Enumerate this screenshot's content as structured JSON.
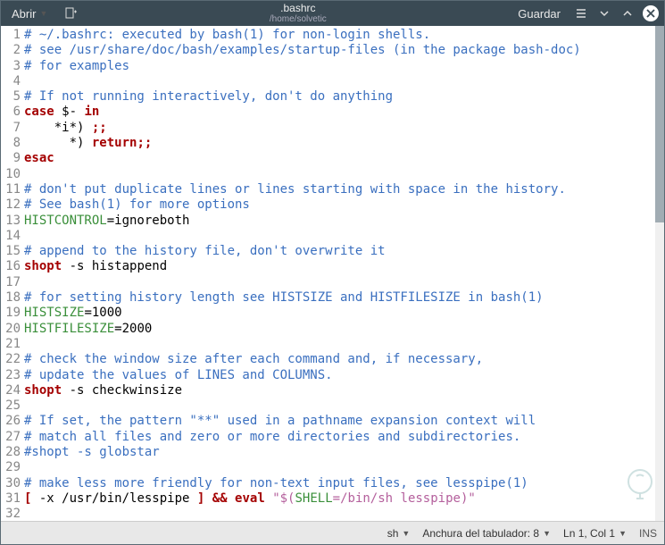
{
  "titlebar": {
    "open_label": "Abrir",
    "title": ".bashrc",
    "subtitle": "/home/solvetic",
    "save_label": "Guardar"
  },
  "code": {
    "lines": [
      {
        "n": 1,
        "t": [
          [
            "cmt",
            "# ~/.bashrc: executed by bash(1) for non-login shells."
          ]
        ]
      },
      {
        "n": 2,
        "t": [
          [
            "cmt",
            "# see /usr/share/doc/bash/examples/startup-files (in the package bash-doc)"
          ]
        ]
      },
      {
        "n": 3,
        "t": [
          [
            "cmt",
            "# for examples"
          ]
        ]
      },
      {
        "n": 4,
        "t": [
          [
            "",
            ""
          ]
        ]
      },
      {
        "n": 5,
        "t": [
          [
            "cmt",
            "# If not running interactively, don't do anything"
          ]
        ]
      },
      {
        "n": 6,
        "t": [
          [
            "kw",
            "case"
          ],
          [
            "",
            " $- "
          ],
          [
            "kw",
            "in"
          ]
        ]
      },
      {
        "n": 7,
        "t": [
          [
            "",
            "    *i*) "
          ],
          [
            "punc",
            ";;"
          ]
        ]
      },
      {
        "n": 8,
        "t": [
          [
            "",
            "      *) "
          ],
          [
            "kw",
            "return"
          ],
          [
            "punc",
            ";;"
          ]
        ]
      },
      {
        "n": 9,
        "t": [
          [
            "kw",
            "esac"
          ]
        ]
      },
      {
        "n": 10,
        "t": [
          [
            "",
            ""
          ]
        ]
      },
      {
        "n": 11,
        "t": [
          [
            "cmt",
            "# don't put duplicate lines or lines starting with space in the history."
          ]
        ]
      },
      {
        "n": 12,
        "t": [
          [
            "cmt",
            "# See bash(1) for more options"
          ]
        ]
      },
      {
        "n": 13,
        "t": [
          [
            "var",
            "HISTCONTROL"
          ],
          [
            "",
            "=ignoreboth"
          ]
        ]
      },
      {
        "n": 14,
        "t": [
          [
            "",
            ""
          ]
        ]
      },
      {
        "n": 15,
        "t": [
          [
            "cmt",
            "# append to the history file, don't overwrite it"
          ]
        ]
      },
      {
        "n": 16,
        "t": [
          [
            "kw",
            "shopt"
          ],
          [
            "",
            " -s histappend"
          ]
        ]
      },
      {
        "n": 17,
        "t": [
          [
            "",
            ""
          ]
        ]
      },
      {
        "n": 18,
        "t": [
          [
            "cmt",
            "# for setting history length see HISTSIZE and HISTFILESIZE in bash(1)"
          ]
        ]
      },
      {
        "n": 19,
        "t": [
          [
            "var",
            "HISTSIZE"
          ],
          [
            "",
            "=1000"
          ]
        ]
      },
      {
        "n": 20,
        "t": [
          [
            "var",
            "HISTFILESIZE"
          ],
          [
            "",
            "=2000"
          ]
        ]
      },
      {
        "n": 21,
        "t": [
          [
            "",
            ""
          ]
        ]
      },
      {
        "n": 22,
        "t": [
          [
            "cmt",
            "# check the window size after each command and, if necessary,"
          ]
        ]
      },
      {
        "n": 23,
        "t": [
          [
            "cmt",
            "# update the values of LINES and COLUMNS."
          ]
        ]
      },
      {
        "n": 24,
        "t": [
          [
            "kw",
            "shopt"
          ],
          [
            "",
            " -s checkwinsize"
          ]
        ]
      },
      {
        "n": 25,
        "t": [
          [
            "",
            ""
          ]
        ]
      },
      {
        "n": 26,
        "t": [
          [
            "cmt",
            "# If set, the pattern \"**\" used in a pathname expansion context will"
          ]
        ]
      },
      {
        "n": 27,
        "t": [
          [
            "cmt",
            "# match all files and zero or more directories and subdirectories."
          ]
        ]
      },
      {
        "n": 28,
        "t": [
          [
            "cmt",
            "#shopt -s globstar"
          ]
        ]
      },
      {
        "n": 29,
        "t": [
          [
            "",
            ""
          ]
        ]
      },
      {
        "n": 30,
        "t": [
          [
            "cmt",
            "# make less more friendly for non-text input files, see lesspipe(1)"
          ]
        ]
      },
      {
        "n": 31,
        "t": [
          [
            "kw",
            "["
          ],
          [
            "",
            " -x /usr/bin/lesspipe "
          ],
          [
            "kw",
            "]"
          ],
          [
            "",
            " "
          ],
          [
            "kw",
            "&&"
          ],
          [
            "",
            " "
          ],
          [
            "kw",
            "eval"
          ],
          [
            "",
            " "
          ],
          [
            "str",
            "\"$("
          ],
          [
            "var",
            "SHELL"
          ],
          [
            "str",
            "=/bin/sh lesspipe)\""
          ]
        ]
      },
      {
        "n": 32,
        "t": [
          [
            "",
            ""
          ]
        ]
      }
    ]
  },
  "statusbar": {
    "lang": "sh",
    "tab_label": "Anchura del tabulador: 8",
    "pos": "Ln 1, Col 1",
    "mode": "INS"
  }
}
